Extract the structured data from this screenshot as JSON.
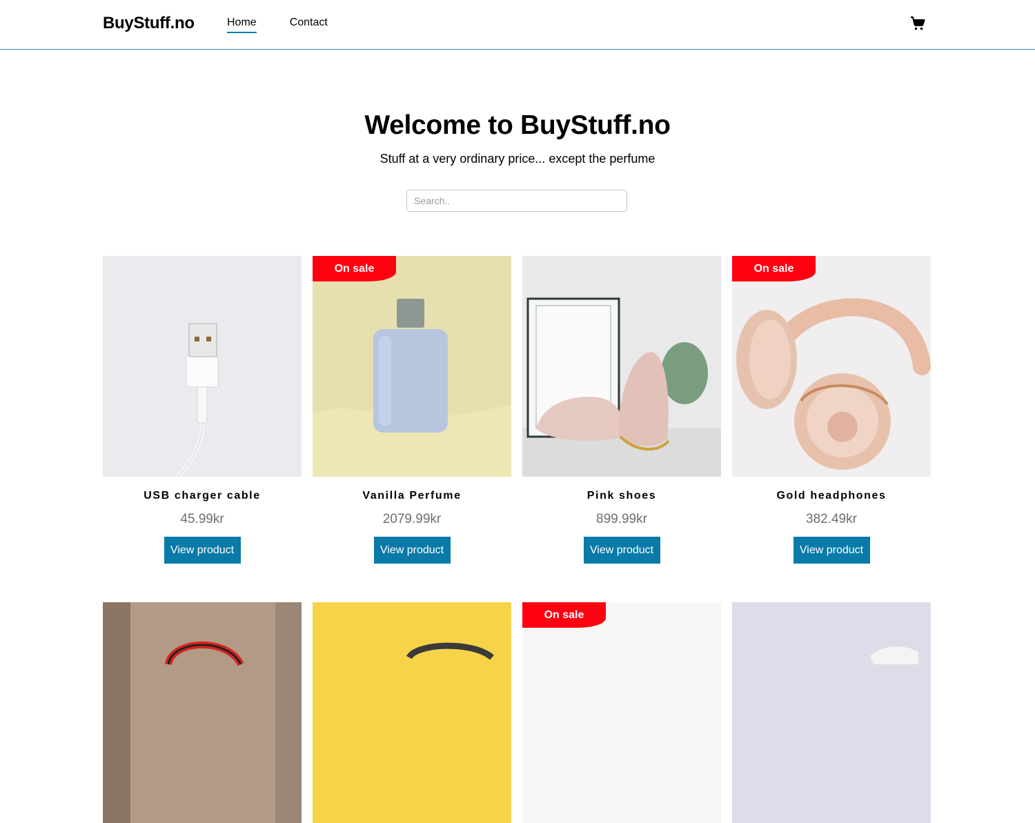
{
  "header": {
    "logo": "BuyStuff.no",
    "nav": [
      {
        "label": "Home",
        "active": true
      },
      {
        "label": "Contact",
        "active": false
      }
    ],
    "cart_icon": "shopping-cart-icon",
    "accent": "#0a7aa8"
  },
  "hero": {
    "title": "Welcome to BuyStuff.no",
    "subtitle": "Stuff at a very ordinary price... except the perfume"
  },
  "search": {
    "placeholder": "Search.."
  },
  "products": [
    {
      "name": "USB charger cable",
      "price": "45.99kr",
      "on_sale": false,
      "button": "View product"
    },
    {
      "name": "Vanilla Perfume",
      "price": "2079.99kr",
      "on_sale": true,
      "badge": "On sale",
      "button": "View product"
    },
    {
      "name": "Pink shoes",
      "price": "899.99kr",
      "on_sale": false,
      "button": "View product"
    },
    {
      "name": "Gold headphones",
      "price": "382.49kr",
      "on_sale": true,
      "badge": "On sale",
      "button": "View product"
    }
  ],
  "products_row2": [
    {
      "on_sale": false
    },
    {
      "on_sale": false
    },
    {
      "on_sale": true,
      "badge": "On sale"
    },
    {
      "on_sale": false
    }
  ],
  "colors": {
    "sale_badge": "#ff0011",
    "button": "#0a7aa8",
    "price": "#6e6e6e"
  }
}
